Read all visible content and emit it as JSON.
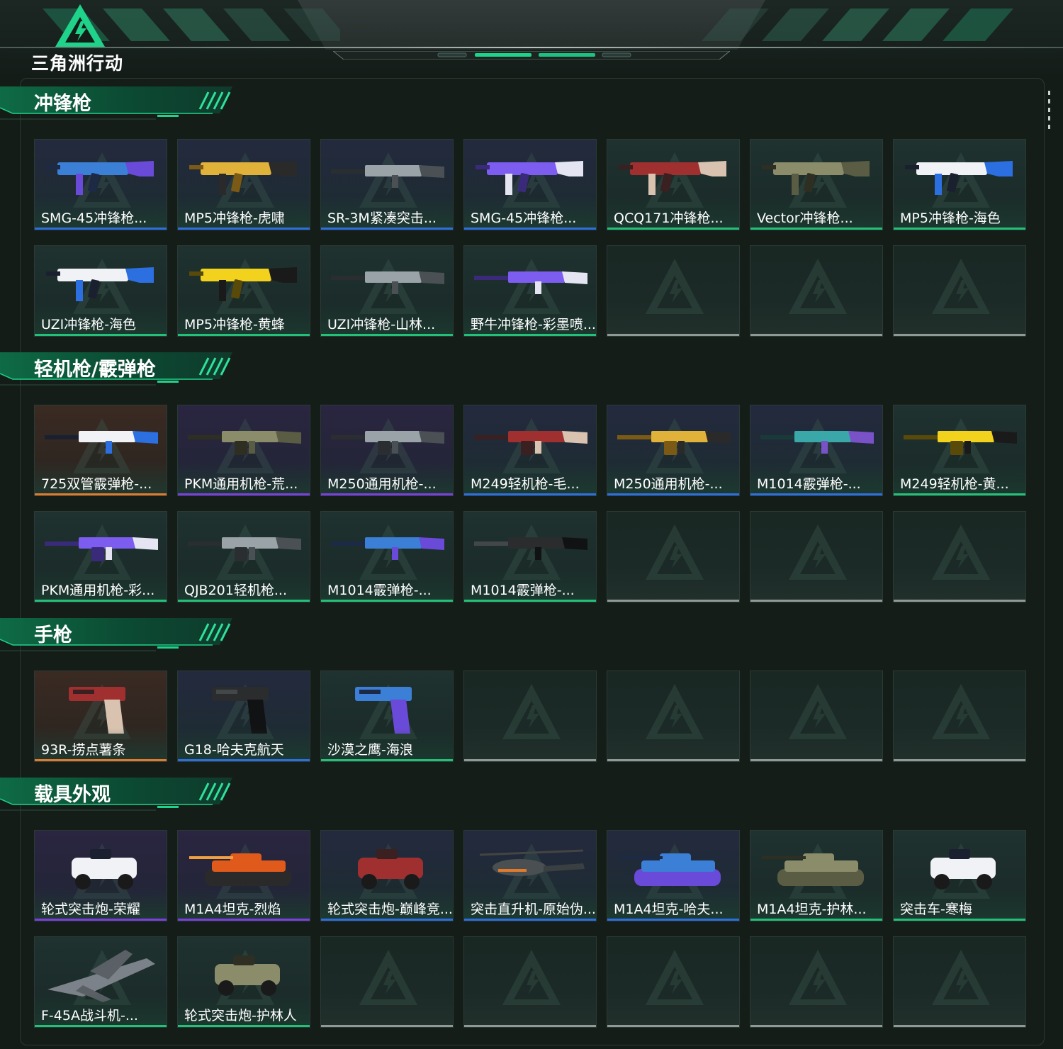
{
  "brand": {
    "logo_text": "三角洲行动",
    "accent": "#1fd38b"
  },
  "quality_colors": {
    "blue": "#2c6fe0",
    "purple": "#7b3fe0",
    "orange": "#e07a2c",
    "green": "#23c07a",
    "empty": "#8f9995"
  },
  "sections": [
    {
      "title": "冲锋枪",
      "items": [
        {
          "name": "SMG-45冲锋枪...",
          "quality": "blue",
          "art": "smg-blue-icon"
        },
        {
          "name": "MP5冲锋枪-虎啸",
          "quality": "blue",
          "art": "smg-gold-icon"
        },
        {
          "name": "SR-3M紧凑突击...",
          "quality": "blue",
          "art": "rifle-gray-icon"
        },
        {
          "name": "SMG-45冲锋枪...",
          "quality": "blue",
          "art": "smg-purple-icon"
        },
        {
          "name": "QCQ171冲锋枪...",
          "quality": "green",
          "art": "smg-red-icon"
        },
        {
          "name": "Vector冲锋枪...",
          "quality": "green",
          "art": "smg-camo-icon"
        },
        {
          "name": "MP5冲锋枪-海色",
          "quality": "green",
          "art": "smg-white-icon"
        },
        {
          "name": "UZI冲锋枪-海色",
          "quality": "green",
          "art": "uzi-white-icon"
        },
        {
          "name": "MP5冲锋枪-黄蜂",
          "quality": "green",
          "art": "smg-yellow-icon"
        },
        {
          "name": "UZI冲锋枪-山林...",
          "quality": "green",
          "art": "rifle-gray-icon"
        },
        {
          "name": "野牛冲锋枪-彩墨喷...",
          "quality": "green",
          "art": "rifle-purple-icon"
        },
        {
          "name": "",
          "quality": "empty",
          "art": ""
        },
        {
          "name": "",
          "quality": "empty",
          "art": ""
        },
        {
          "name": "",
          "quality": "empty",
          "art": ""
        }
      ]
    },
    {
      "title": "轻机枪/霰弹枪",
      "items": [
        {
          "name": "725双管霰弹枪-...",
          "quality": "orange",
          "art": "shotgun-white-icon"
        },
        {
          "name": "PKM通用机枪-荒...",
          "quality": "purple",
          "art": "lmg-camo-icon"
        },
        {
          "name": "M250通用机枪-...",
          "quality": "purple",
          "art": "lmg-gray-icon"
        },
        {
          "name": "M249轻机枪-毛...",
          "quality": "blue",
          "art": "lmg-red-icon"
        },
        {
          "name": "M250通用机枪-...",
          "quality": "blue",
          "art": "lmg-gold-icon"
        },
        {
          "name": "M1014霰弹枪-...",
          "quality": "blue",
          "art": "shotgun-teal-icon"
        },
        {
          "name": "M249轻机枪-黄...",
          "quality": "green",
          "art": "lmg-yellow-icon"
        },
        {
          "name": "PKM通用机枪-彩...",
          "quality": "green",
          "art": "lmg-purple-icon"
        },
        {
          "name": "QJB201轻机枪...",
          "quality": "green",
          "art": "lmg-gray-icon"
        },
        {
          "name": "M1014霰弹枪-...",
          "quality": "green",
          "art": "shotgun-blue-icon"
        },
        {
          "name": "M1014霰弹枪-...",
          "quality": "green",
          "art": "shotgun-black-icon"
        },
        {
          "name": "",
          "quality": "empty",
          "art": ""
        },
        {
          "name": "",
          "quality": "empty",
          "art": ""
        },
        {
          "name": "",
          "quality": "empty",
          "art": ""
        }
      ]
    },
    {
      "title": "手枪",
      "items": [
        {
          "name": "93R-捞点薯条",
          "quality": "orange",
          "art": "pistol-red-icon"
        },
        {
          "name": "G18-哈夫克航天",
          "quality": "blue",
          "art": "pistol-black-icon"
        },
        {
          "name": "沙漠之鹰-海浪",
          "quality": "green",
          "art": "pistol-blue-icon"
        },
        {
          "name": "",
          "quality": "empty",
          "art": ""
        },
        {
          "name": "",
          "quality": "empty",
          "art": ""
        },
        {
          "name": "",
          "quality": "empty",
          "art": ""
        },
        {
          "name": "",
          "quality": "empty",
          "art": ""
        }
      ]
    },
    {
      "title": "载具外观",
      "items": [
        {
          "name": "轮式突击炮-荣耀",
          "quality": "purple",
          "art": "vehicle-white-icon"
        },
        {
          "name": "M1A4坦克-烈焰",
          "quality": "purple",
          "art": "tank-flame-icon"
        },
        {
          "name": "轮式突击炮-巅峰竞...",
          "quality": "blue",
          "art": "vehicle-red-icon"
        },
        {
          "name": "突击直升机-原始伪...",
          "quality": "blue",
          "art": "helicopter-icon"
        },
        {
          "name": "M1A4坦克-哈夫...",
          "quality": "blue",
          "art": "tank-blue-icon"
        },
        {
          "name": "M1A4坦克-护林...",
          "quality": "green",
          "art": "tank-camo-icon"
        },
        {
          "name": "突击车-寒梅",
          "quality": "green",
          "art": "vehicle-white-icon"
        },
        {
          "name": "F-45A战斗机-...",
          "quality": "green",
          "art": "jet-icon"
        },
        {
          "name": "轮式突击炮-护林人",
          "quality": "green",
          "art": "vehicle-camo-icon"
        },
        {
          "name": "",
          "quality": "empty",
          "art": ""
        },
        {
          "name": "",
          "quality": "empty",
          "art": ""
        },
        {
          "name": "",
          "quality": "empty",
          "art": ""
        },
        {
          "name": "",
          "quality": "empty",
          "art": ""
        },
        {
          "name": "",
          "quality": "empty",
          "art": ""
        }
      ]
    }
  ]
}
